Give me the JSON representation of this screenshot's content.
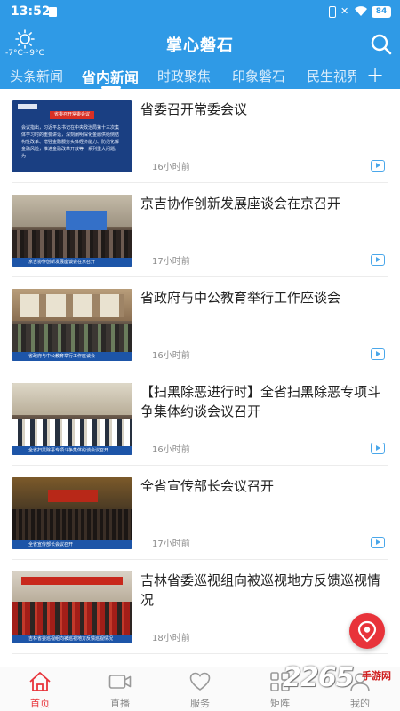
{
  "status_bar": {
    "time": "13:52",
    "battery": "84"
  },
  "header": {
    "weather": "-7°C~9°C",
    "title": "掌心磐石"
  },
  "tabs": [
    "头条新闻",
    "省内新闻",
    "时政聚焦",
    "印象磐石",
    "民生视界"
  ],
  "active_tab": "省内新闻",
  "news": [
    {
      "title": "省委召开常委会议",
      "time": "16小时前",
      "thumb_title": "省委召开常委会议",
      "thumb_text": "会议指出，习近平总书记在中央政治局第十三次集体学习时的重要讲话，深刻阐明深化金融供给侧结构性改革、增强金融服务实体经济能力、防范化解金融风险，推进金融改革开放等一系列重大问题。为"
    },
    {
      "title": "京吉协作创新发展座谈会在京召开",
      "time": "17小时前",
      "thumb_caption": "京吉协作创新发展座谈会在京召开"
    },
    {
      "title": "省政府与中公教育举行工作座谈会",
      "time": "16小时前",
      "thumb_caption": "省政府与中公教育举行工作座谈会"
    },
    {
      "title": "【扫黑除恶进行时】全省扫黑除恶专项斗争集体约谈会议召开",
      "time": "16小时前",
      "thumb_caption": "全省扫黑除恶专项斗争集体约谈会议召开"
    },
    {
      "title": "全省宣传部长会议召开",
      "time": "17小时前",
      "thumb_caption": "全省宣传部长会议召开"
    },
    {
      "title": "吉林省委巡视组向被巡视地方反馈巡视情况",
      "time": "18小时前",
      "thumb_caption": "吉林省委巡视组向被巡视地方反馈巡视情况"
    }
  ],
  "bottom_nav": [
    {
      "label": "首页",
      "icon": "home-icon"
    },
    {
      "label": "直播",
      "icon": "video-camera-icon"
    },
    {
      "label": "服务",
      "icon": "heart-icon"
    },
    {
      "label": "矩阵",
      "icon": "grid-icon"
    },
    {
      "label": "我的",
      "icon": "person-icon"
    }
  ],
  "watermark": {
    "logo": "2265",
    "suffix": ".com",
    "text": "手游网"
  },
  "colors": {
    "brand": "#2f9ae6",
    "accent": "#e8333a"
  }
}
